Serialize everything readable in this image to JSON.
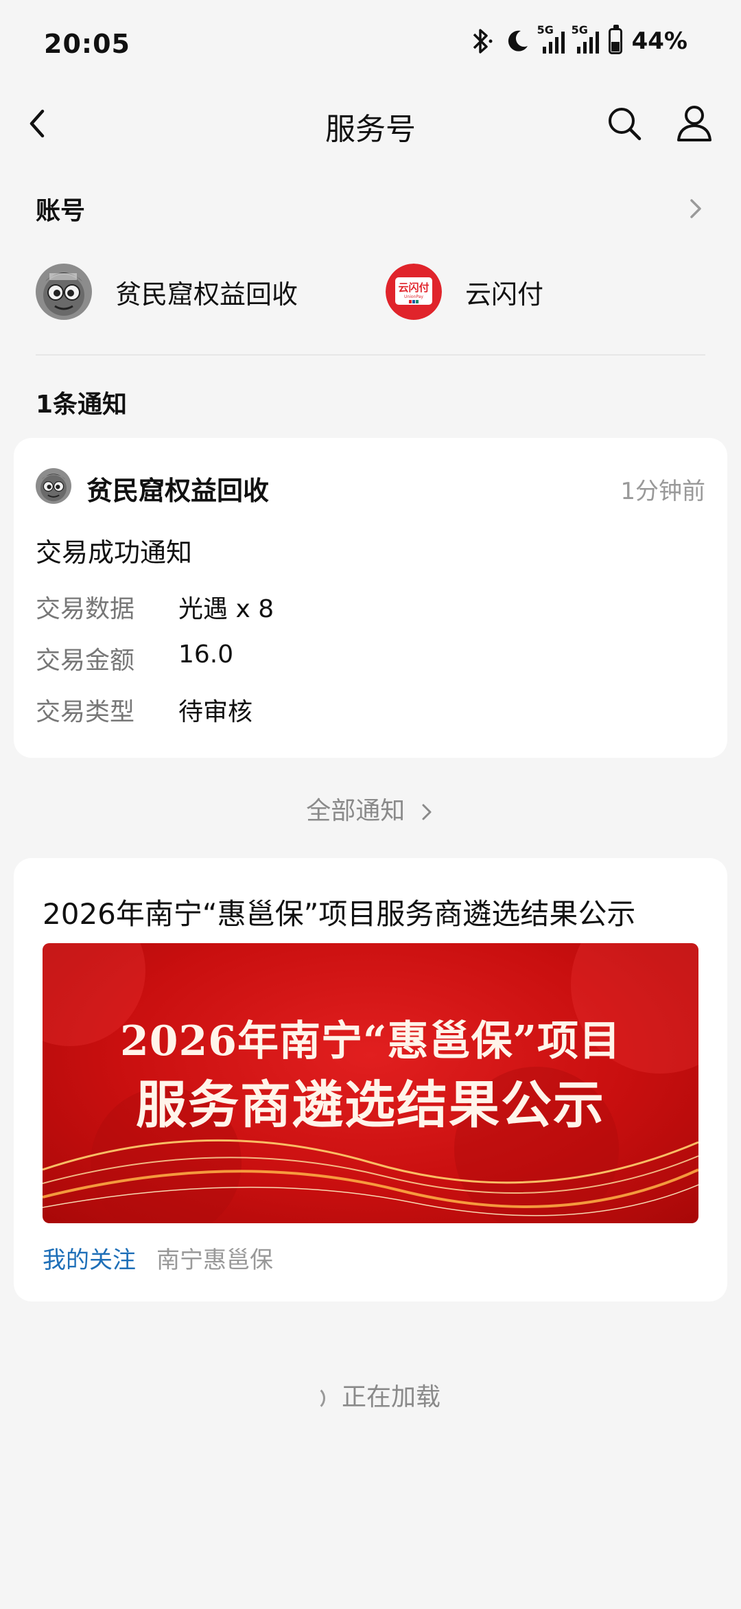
{
  "status_bar": {
    "time": "20:05",
    "battery": "44%",
    "battery_level": 0.44,
    "signal_1_label": "5G",
    "signal_2_label": "5G"
  },
  "nav": {
    "title": "服务号",
    "back_icon": "chevron-left-icon",
    "search_icon": "search-icon",
    "user_icon": "user-icon"
  },
  "accounts": {
    "title": "账号",
    "items": [
      {
        "name": "贫民窟权益回收",
        "avatar": "cartoon-avatar"
      },
      {
        "name": "云闪付",
        "avatar": "unionpay-logo",
        "logo_text": "云闪付",
        "logo_sub": "UnionPay"
      }
    ]
  },
  "notifications": {
    "title": "1条通知",
    "card": {
      "sender": "贫民窟权益回收",
      "time": "1分钟前",
      "heading": "交易成功通知",
      "rows": [
        {
          "label": "交易数据",
          "value": "光遇 x 8"
        },
        {
          "label": "交易金额",
          "value": "16.0"
        },
        {
          "label": "交易类型",
          "value": "待审核"
        }
      ]
    },
    "all_link": "全部通知"
  },
  "article": {
    "title": "2026年南宁“惠邕保”项目服务商遴选结果公示",
    "banner_line1": "2026年南宁“惠邕保”项目",
    "banner_line2": "服务商遴选结果公示",
    "tag": "我的关注",
    "source": "南宁惠邕保"
  },
  "footer": {
    "loading_text": "正在加载"
  },
  "colors": {
    "background": "#f5f5f5",
    "card": "#ffffff",
    "link_blue": "#1e6fb8",
    "banner_red": "#d41414"
  }
}
